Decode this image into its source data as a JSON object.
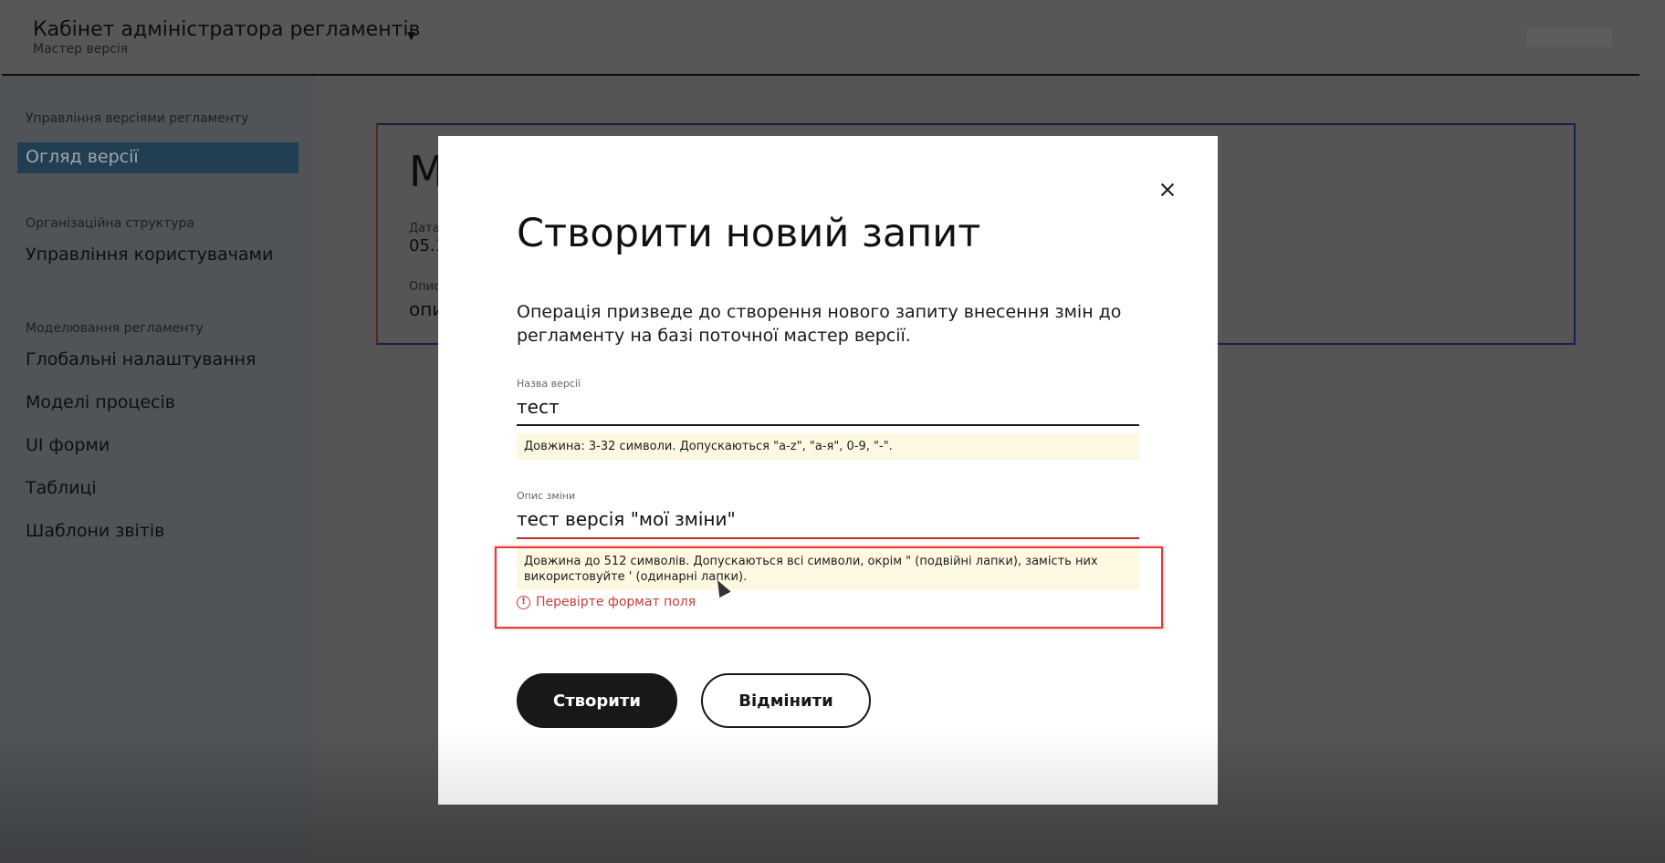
{
  "header": {
    "title": "Кабінет адміністратора регламентів",
    "subtitle": "Мастер версія"
  },
  "sidebar": {
    "sections": [
      {
        "label": "Управління версіями регламенту",
        "items": [
          {
            "label": "Огляд версії",
            "active": true
          }
        ]
      },
      {
        "label": "Організаційна структура",
        "items": [
          {
            "label": "Управління користувачами"
          }
        ]
      },
      {
        "label": "Моделювання регламенту",
        "items": [
          {
            "label": "Глобальні налаштування"
          },
          {
            "label": "Моделі процесів"
          },
          {
            "label": "UI форми"
          },
          {
            "label": "Таблиці"
          },
          {
            "label": "Шаблони звітів"
          }
        ]
      }
    ]
  },
  "background_card": {
    "heading": "М",
    "date_label": "Дата",
    "date_value": "05.1",
    "desc_label": "Опис",
    "desc_value": "опи"
  },
  "modal": {
    "title": "Створити новий запит",
    "description": "Операція призведе до створення нового запиту внесення змін до регламенту на базі поточної мастер версії.",
    "fields": {
      "version_name": {
        "label": "Назва версії",
        "value": "тест",
        "hint": "Довжина: 3-32 символи. Допускаються \"a-z\", \"а-я\", 0-9, \"-\"."
      },
      "change_description": {
        "label": "Опис зміни",
        "value": "тест версія \"мої зміни\"",
        "hint": "Довжина до 512 символів. Допускаються всі символи, окрім \" (подвійні лапки), замість них використовуйте ' (одинарні лапки).",
        "error": "Перевірте формат поля"
      }
    },
    "buttons": {
      "create": "Створити",
      "cancel": "Відмінити"
    }
  },
  "colors": {
    "error": "#c83c3c",
    "highlight": "#e23c3c",
    "hint_bg": "#fdf8e1",
    "active_nav": "#223e52"
  }
}
